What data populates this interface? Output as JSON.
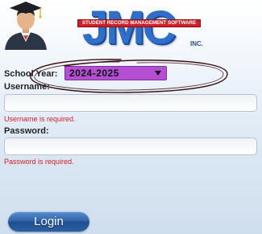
{
  "logo": {
    "brand": "JMC",
    "banner": "STUDENT RECORD MANAGEMENT SOFTWARE",
    "suffix": "INC."
  },
  "school_year": {
    "label": "School Year:",
    "selected": "2024-2025"
  },
  "username": {
    "label": "Username:",
    "value": "",
    "error": "Username is required."
  },
  "password": {
    "label": "Password:",
    "value": "",
    "error": "Password is required."
  },
  "login_button": {
    "label": "Login"
  },
  "colors": {
    "select_bg": "#b44fd3",
    "error": "#d4202a",
    "button": "#2f63a8",
    "logo_blue": "#2f6ec9",
    "logo_red": "#cf2027"
  },
  "icons": [
    "graduate-avatar-icon",
    "dropdown-arrow-icon"
  ]
}
